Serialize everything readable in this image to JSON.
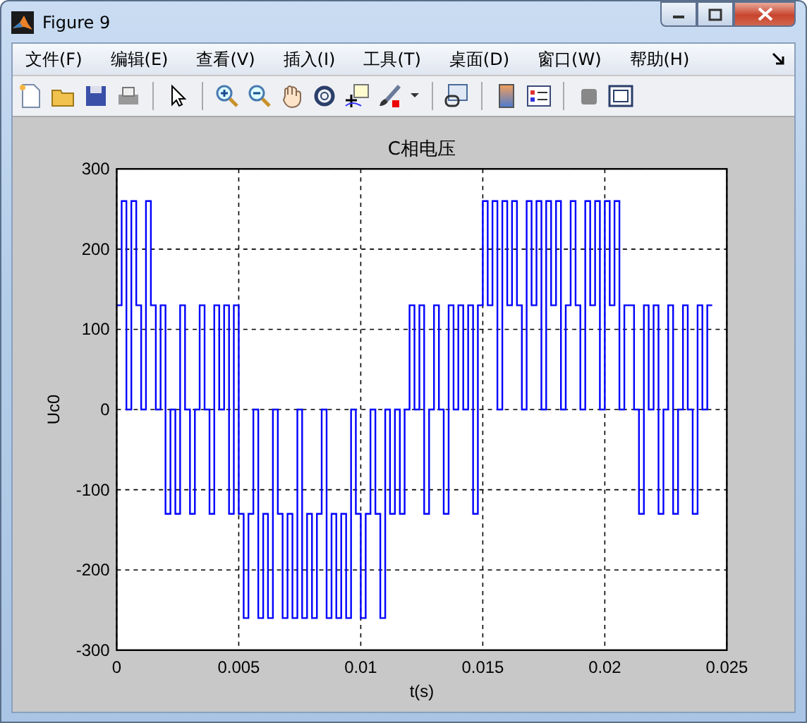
{
  "window": {
    "title": "Figure 9"
  },
  "menu": [
    {
      "label": "文件(F)"
    },
    {
      "label": "编辑(E)"
    },
    {
      "label": "查看(V)"
    },
    {
      "label": "插入(I)"
    },
    {
      "label": "工具(T)"
    },
    {
      "label": "桌面(D)"
    },
    {
      "label": "窗口(W)"
    },
    {
      "label": "帮助(H)"
    }
  ],
  "figure": {
    "chart_data": {
      "type": "line",
      "title": "C相电压",
      "xlabel": "t(s)",
      "ylabel": "Uc0",
      "xlim": [
        0,
        0.025
      ],
      "ylim": [
        -300,
        300
      ],
      "xticks": [
        0,
        0.005,
        0.01,
        0.015,
        0.02,
        0.025
      ],
      "yticks": [
        -300,
        -200,
        -100,
        0,
        100,
        200,
        300
      ],
      "grid": true,
      "x": [
        0,
        0.0002,
        0.0002,
        0.0004,
        0.0004,
        0.0006,
        0.0006,
        0.0008,
        0.0008,
        0.001,
        0.001,
        0.0012,
        0.0012,
        0.0014,
        0.0014,
        0.0016,
        0.0016,
        0.0018,
        0.0018,
        0.002,
        0.002,
        0.0022,
        0.0022,
        0.0024,
        0.0024,
        0.0026,
        0.0026,
        0.0028,
        0.0028,
        0.003,
        0.003,
        0.0032,
        0.0032,
        0.0034,
        0.0034,
        0.0036,
        0.0036,
        0.0038,
        0.0038,
        0.004,
        0.004,
        0.0042,
        0.0042,
        0.0044,
        0.0044,
        0.0046,
        0.0046,
        0.0048,
        0.0048,
        0.005,
        0.005,
        0.0052,
        0.0052,
        0.0054,
        0.0054,
        0.0056,
        0.0056,
        0.0058,
        0.0058,
        0.006,
        0.006,
        0.0062,
        0.0062,
        0.0064,
        0.0064,
        0.0066,
        0.0066,
        0.0068,
        0.0068,
        0.007,
        0.007,
        0.0072,
        0.0072,
        0.0074,
        0.0074,
        0.0076,
        0.0076,
        0.0078,
        0.0078,
        0.008,
        0.008,
        0.0082,
        0.0082,
        0.0084,
        0.0084,
        0.0086,
        0.0086,
        0.0088,
        0.0088,
        0.009,
        0.009,
        0.0092,
        0.0092,
        0.0094,
        0.0094,
        0.0096,
        0.0096,
        0.0098,
        0.0098,
        0.01,
        0.01,
        0.0102,
        0.0102,
        0.0104,
        0.0104,
        0.0106,
        0.0106,
        0.0108,
        0.0108,
        0.011,
        0.011,
        0.0112,
        0.0112,
        0.0114,
        0.0114,
        0.0116,
        0.0116,
        0.0118,
        0.0118,
        0.012,
        0.012,
        0.0122,
        0.0122,
        0.0124,
        0.0124,
        0.0126,
        0.0126,
        0.0128,
        0.0128,
        0.013,
        0.013,
        0.0132,
        0.0132,
        0.0134,
        0.0134,
        0.0136,
        0.0136,
        0.0138,
        0.0138,
        0.014,
        0.014,
        0.0142,
        0.0142,
        0.0144,
        0.0144,
        0.0146,
        0.0146,
        0.0148,
        0.0148,
        0.015,
        0.015,
        0.0152,
        0.0152,
        0.0154,
        0.0154,
        0.0156,
        0.0156,
        0.0158,
        0.0158,
        0.016,
        0.016,
        0.0162,
        0.0162,
        0.0164,
        0.0164,
        0.0166,
        0.0166,
        0.0168,
        0.0168,
        0.017,
        0.017,
        0.0172,
        0.0172,
        0.0174,
        0.0174,
        0.0176,
        0.0176,
        0.0178,
        0.0178,
        0.018,
        0.018,
        0.0182,
        0.0182,
        0.0184,
        0.0184,
        0.0186,
        0.0186,
        0.0188,
        0.0188,
        0.019,
        0.019,
        0.0192,
        0.0192,
        0.0194,
        0.0194,
        0.0196,
        0.0196,
        0.0198,
        0.0198,
        0.02,
        0.02,
        0.0202,
        0.0202,
        0.0204,
        0.0204,
        0.0206,
        0.0206,
        0.0208,
        0.0208,
        0.021,
        0.021,
        0.0212,
        0.0212,
        0.0214,
        0.0214,
        0.0216,
        0.0216,
        0.0218,
        0.0218,
        0.022,
        0.022,
        0.0222,
        0.0222,
        0.0224,
        0.0224,
        0.0226,
        0.0226,
        0.0228,
        0.0228,
        0.023,
        0.023,
        0.0232,
        0.0232,
        0.0234,
        0.0234,
        0.0236,
        0.0236,
        0.0238,
        0.0238,
        0.024,
        0.024,
        0.0242,
        0.0242,
        0.0244
      ],
      "series": [
        {
          "color": "#0000ff",
          "values": [
            130,
            130,
            260,
            260,
            0,
            0,
            260,
            260,
            130,
            130,
            0,
            0,
            260,
            260,
            130,
            130,
            0,
            0,
            130,
            130,
            -130,
            -130,
            0,
            0,
            -130,
            -130,
            130,
            130,
            0,
            0,
            -130,
            -130,
            0,
            0,
            130,
            130,
            0,
            0,
            -130,
            -130,
            130,
            130,
            0,
            0,
            130,
            130,
            -130,
            -130,
            130,
            130,
            -130,
            -130,
            -260,
            -260,
            -130,
            -130,
            0,
            0,
            -260,
            -260,
            -130,
            -130,
            -260,
            -260,
            0,
            0,
            -130,
            -130,
            -260,
            -260,
            -130,
            -130,
            -260,
            -260,
            0,
            0,
            -260,
            -260,
            -130,
            -130,
            -260,
            -260,
            -130,
            -130,
            0,
            0,
            -260,
            -260,
            -130,
            -130,
            -260,
            -260,
            -130,
            -130,
            -260,
            -260,
            0,
            0,
            -130,
            -130,
            -260,
            -260,
            -130,
            -130,
            0,
            0,
            -130,
            -130,
            -260,
            -260,
            0,
            0,
            -130,
            -130,
            0,
            0,
            -130,
            -130,
            0,
            0,
            130,
            130,
            0,
            0,
            130,
            130,
            -130,
            -130,
            0,
            0,
            130,
            130,
            0,
            0,
            -130,
            -130,
            130,
            130,
            0,
            0,
            130,
            130,
            0,
            0,
            130,
            130,
            -130,
            -130,
            130,
            130,
            260,
            260,
            130,
            130,
            260,
            260,
            0,
            0,
            260,
            260,
            130,
            130,
            260,
            260,
            130,
            130,
            0,
            0,
            260,
            260,
            130,
            130,
            260,
            260,
            0,
            0,
            260,
            260,
            130,
            130,
            260,
            260,
            0,
            0,
            130,
            130,
            260,
            260,
            130,
            130,
            0,
            0,
            260,
            260,
            130,
            130,
            260,
            260,
            0,
            0,
            260,
            260,
            130,
            130,
            260,
            260,
            0,
            0,
            130,
            130,
            130,
            130,
            0,
            0,
            -130,
            -130,
            130,
            130,
            0,
            0,
            130,
            130,
            -130,
            -130,
            0,
            0,
            130,
            130,
            -130,
            -130,
            0,
            0,
            130,
            130,
            0,
            0,
            -130,
            -130,
            130,
            130,
            0,
            0,
            130,
            130
          ]
        }
      ]
    }
  }
}
